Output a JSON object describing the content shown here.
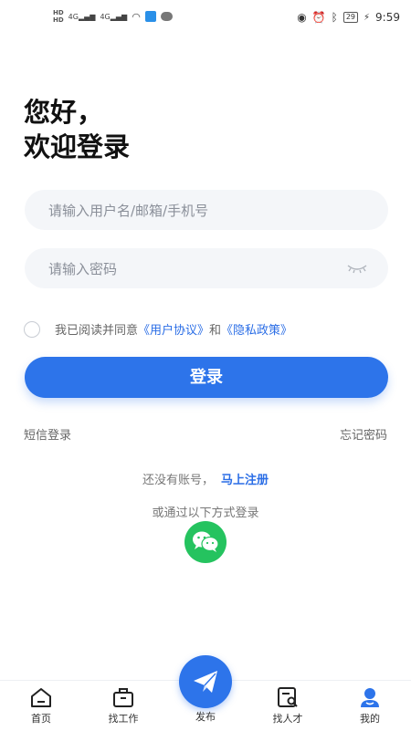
{
  "status_bar": {
    "left_hd1": "HD",
    "left_hd2": "HD",
    "net1": "4G",
    "net2": "4G",
    "battery": "29",
    "time": "9:59"
  },
  "greeting": {
    "line1": "您好，",
    "line2": "欢迎登录"
  },
  "username": {
    "placeholder": "请输入用户名/邮箱/手机号",
    "value": ""
  },
  "password": {
    "placeholder": "请输入密码",
    "value": ""
  },
  "agreement": {
    "prefix": "我已阅读并同意",
    "user_agreement": "《用户协议》",
    "and": "和",
    "privacy_policy": "《隐私政策》"
  },
  "login_button": "登录",
  "sms_login": "短信登录",
  "forgot_password": "忘记密码",
  "register": {
    "prompt": "还没有账号，",
    "link": "马上注册"
  },
  "other_login": "或通过以下方式登录",
  "tabs": [
    {
      "label": "首页",
      "icon": "home-icon"
    },
    {
      "label": "找工作",
      "icon": "briefcase-icon"
    },
    {
      "label": "发布",
      "icon": "send-icon"
    },
    {
      "label": "找人才",
      "icon": "talent-search-icon"
    },
    {
      "label": "我的",
      "icon": "profile-icon"
    }
  ],
  "colors": {
    "primary": "#2d74ea",
    "link": "#2b6ee6",
    "wechat": "#25c35f"
  }
}
